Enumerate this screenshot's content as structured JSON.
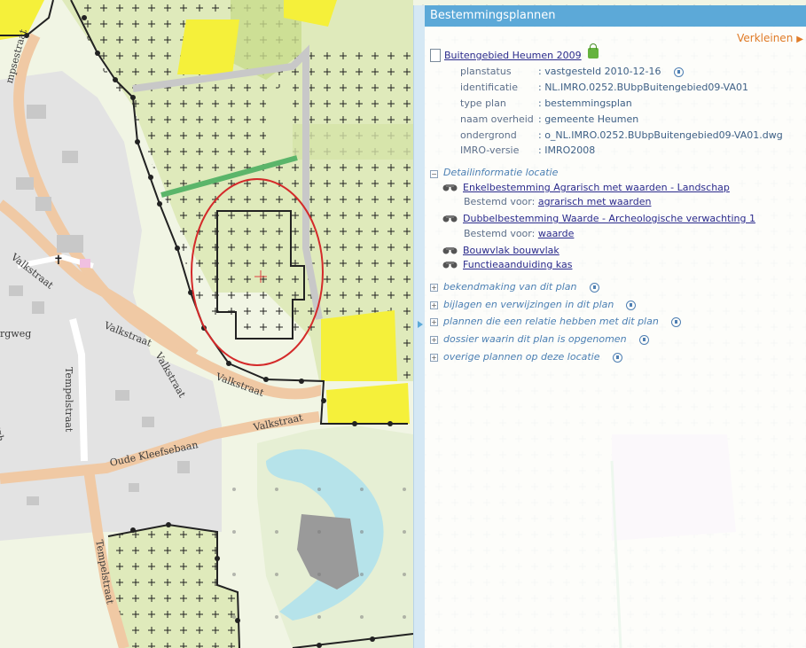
{
  "map": {
    "street_labels": [
      "Valkstraat",
      "Valkstraat",
      "Valkstraat",
      "Valkstraat",
      "Tempelstraat",
      "Tempelstraat",
      "Oude Kleefsebaan",
      "rgweg",
      "mpsestraat",
      "ebergh"
    ]
  },
  "panel": {
    "title": "Bestemmingsplannen",
    "shrink_label": "Verkleinen",
    "plan_name": "Buitengebied Heumen 2009",
    "properties": [
      {
        "key": "planstatus",
        "value": ": vastgesteld 2010-12-16",
        "info": true
      },
      {
        "key": "identificatie",
        "value": ": NL.IMRO.0252.BUbpBuitengebied09-VA01",
        "info": false
      },
      {
        "key": "type plan",
        "value": ": bestemmingsplan",
        "info": false
      },
      {
        "key": "naam overheid",
        "value": ": gemeente Heumen",
        "info": false
      },
      {
        "key": "ondergrond",
        "value": ": o_NL.IMRO.0252.BUbpBuitengebied09-VA01.dwg",
        "info": false
      },
      {
        "key": "IMRO-versie",
        "value": ": IMRO2008",
        "info": false
      }
    ],
    "detail_title": "Detailinformatie locatie",
    "bestemmingen": [
      {
        "label": "Enkelbestemming Agrarisch met waarden - Landschap",
        "sub_prefix": "Bestemd voor:",
        "sub_link": "agrarisch met waarden"
      },
      {
        "label": "Dubbelbestemming Waarde - Archeologische verwachting 1",
        "sub_prefix": "Bestemd voor:",
        "sub_link": "waarde"
      },
      {
        "label": "Bouwvlak bouwvlak"
      },
      {
        "label": "Functieaanduiding kas"
      }
    ],
    "sections": [
      "bekendmaking van dit plan",
      "bijlagen en verwijzingen in dit plan",
      "plannen die een relatie hebben met dit plan",
      "dossier waarin dit plan is opgenomen",
      "overige plannen op deze locatie"
    ]
  }
}
